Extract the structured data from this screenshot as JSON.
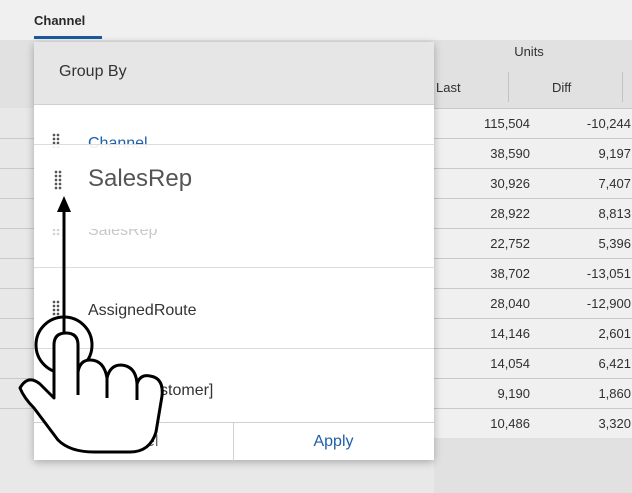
{
  "background": {
    "tab_label": "Channel",
    "units_header": "Units",
    "col_last": "Last",
    "col_diff": "Diff",
    "rows": [
      {
        "last": "115,504",
        "diff": "-10,244"
      },
      {
        "last": "38,590",
        "diff": "9,197"
      },
      {
        "last": "30,926",
        "diff": "7,407"
      },
      {
        "last": "28,922",
        "diff": "8,813"
      },
      {
        "last": "22,752",
        "diff": "5,396"
      },
      {
        "last": "38,702",
        "diff": "-13,051"
      },
      {
        "last": "28,040",
        "diff": "-12,900"
      },
      {
        "last": "14,146",
        "diff": "2,601"
      },
      {
        "last": "14,054",
        "diff": "6,421"
      },
      {
        "last": "9,190",
        "diff": "1,860"
      },
      {
        "last": "10,486",
        "diff": "3,320"
      }
    ]
  },
  "dialog": {
    "title": "Group By",
    "items": [
      {
        "label": "Channel"
      },
      {
        "label": "SalesRep"
      },
      {
        "label": "AssignedRoute"
      },
      {
        "label": "Name [Customer]"
      }
    ],
    "drag_ghost_label": "SalesRep",
    "cancel_label": "Cancel",
    "apply_label": "Apply"
  },
  "colors": {
    "accent": "#1f5fa8",
    "header_bg": "#e6e6e6"
  },
  "icons": [
    "drag-grip-icon",
    "hand-pointer-icon",
    "drag-up-arrow-icon"
  ]
}
